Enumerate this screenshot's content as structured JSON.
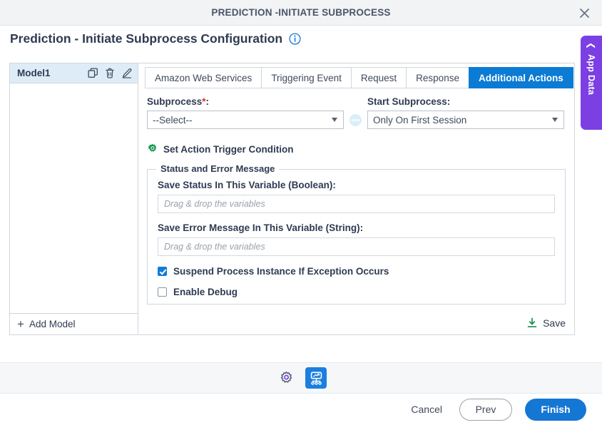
{
  "window": {
    "title": "PREDICTION -INITIATE SUBPROCESS",
    "close_icon": "close-icon"
  },
  "header": {
    "title": "Prediction - Initiate Subprocess Configuration",
    "info_icon": "info-icon"
  },
  "app_data_tab": {
    "label": "App Data",
    "chevron": "chevron-left-icon"
  },
  "model_panel": {
    "items": [
      {
        "name": "Model1",
        "selected": true
      }
    ],
    "icons": {
      "copy": "copy-icon",
      "delete": "trash-icon",
      "edit": "pencil-icon"
    },
    "add_model_label": "Add Model",
    "add_model_icon": "plus-icon"
  },
  "tabs": [
    {
      "label": "Amazon Web Services",
      "active": false
    },
    {
      "label": "Triggering Event",
      "active": false
    },
    {
      "label": "Request",
      "active": false
    },
    {
      "label": "Response",
      "active": false
    },
    {
      "label": "Additional Actions",
      "active": true
    }
  ],
  "form": {
    "subprocess": {
      "label": "Subprocess",
      "required_mark": "*",
      "label_suffix": ":",
      "value": "--Select--"
    },
    "ellipsis_button": "ellipsis-button",
    "start_subprocess": {
      "label": "Start Subprocess:",
      "value": "Only On First Session"
    },
    "trigger_condition": {
      "label": "Set Action Trigger Condition",
      "icon": "gear-icon"
    },
    "status_group": {
      "legend": "Status and Error Message",
      "save_status": {
        "label": "Save Status In This Variable (Boolean):",
        "value": "",
        "placeholder": "Drag & drop the variables"
      },
      "save_error": {
        "label": "Save Error Message In This Variable (String):",
        "value": "",
        "placeholder": "Drag & drop the variables"
      },
      "checkboxes": [
        {
          "label": "Suspend Process Instance If Exception Occurs",
          "checked": true
        },
        {
          "label": "Enable Debug",
          "checked": false
        }
      ]
    },
    "save": {
      "label": "Save",
      "icon": "download-icon"
    }
  },
  "toolbar": {
    "buttons": [
      {
        "name": "settings-icon",
        "active": false
      },
      {
        "name": "process-diagram-icon",
        "active": true
      }
    ]
  },
  "footer": {
    "cancel": "Cancel",
    "prev": "Prev",
    "finish": "Finish"
  },
  "colors": {
    "accent_blue": "#1577d4",
    "tab_active": "#0b7bd4",
    "app_data_purple": "#7b3fe4",
    "green": "#1a8c4a",
    "required_red": "#e02b2b"
  }
}
